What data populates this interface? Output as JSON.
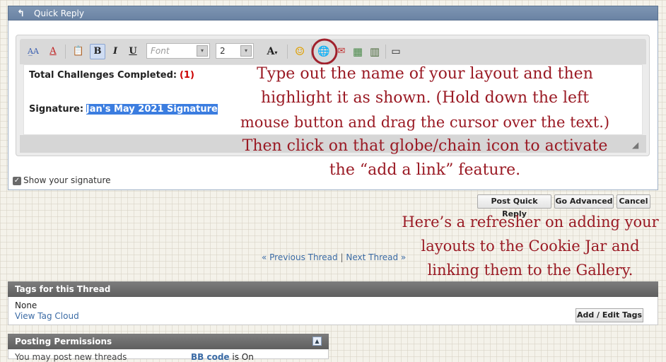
{
  "quick_reply": {
    "title": "Quick Reply",
    "back_glyph": "↰"
  },
  "toolbar": {
    "remove_format_glyph": "A̲A",
    "font_color_glyph": "A",
    "paste_glyph": "📋",
    "bold": "B",
    "italic": "I",
    "underline": "U",
    "font_placeholder": "Font",
    "size_value": "2",
    "text_color_glyph": "A",
    "dropdown_glyph": "▾",
    "smilie_glyph": "☺",
    "link_glyph": "🌐",
    "image_glyph": "▦",
    "video_glyph": "▥",
    "quote_glyph": "▭",
    "icons": [
      "remove-format-icon",
      "font-color-icon",
      "paste-icon",
      "bold-icon",
      "italic-icon",
      "underline-icon",
      "text-color-icon",
      "smilie-icon",
      "insert-link-icon",
      "insert-email-icon",
      "insert-image-icon",
      "insert-video-icon",
      "quote-icon"
    ]
  },
  "editor": {
    "line1_label": "Total Challenges Completed:",
    "line1_value": "(1)",
    "line2_label": "Signature:",
    "line2_selected": "Jan's May 2021 Signature"
  },
  "callout_top": [
    "Type out the name of your layout and then",
    "highlight it as shown. (Hold down the left",
    "mouse button and drag the cursor over the text.)",
    "Then click on that globe/chain icon to activate",
    "the “add a link” feature."
  ],
  "callout_bottom": [
    "Here’s a refresher on adding your",
    "layouts to the Cookie Jar and",
    "linking them to the Gallery."
  ],
  "show_signature": {
    "label": "Show your signature",
    "checked": true
  },
  "actions": {
    "post_quick_reply": "Post Quick Reply",
    "go_advanced": "Go Advanced",
    "cancel": "Cancel"
  },
  "thread_nav": {
    "prev": "« Previous Thread",
    "separator": "|",
    "next": "Next Thread »"
  },
  "tags": {
    "header": "Tags for this Thread",
    "value": "None",
    "cloud_link": "View Tag Cloud",
    "edit_button": "Add / Edit Tags"
  },
  "permissions": {
    "header": "Posting Permissions",
    "row_left": "You may post new threads",
    "bb_code_label": "BB code",
    "bb_code_state": "is On"
  },
  "colors": {
    "callout": "#9a1a24",
    "header_blue": "#6a83a3",
    "link": "#3b6ba5",
    "selection": "#3b7de0",
    "circle": "#a0202c"
  }
}
